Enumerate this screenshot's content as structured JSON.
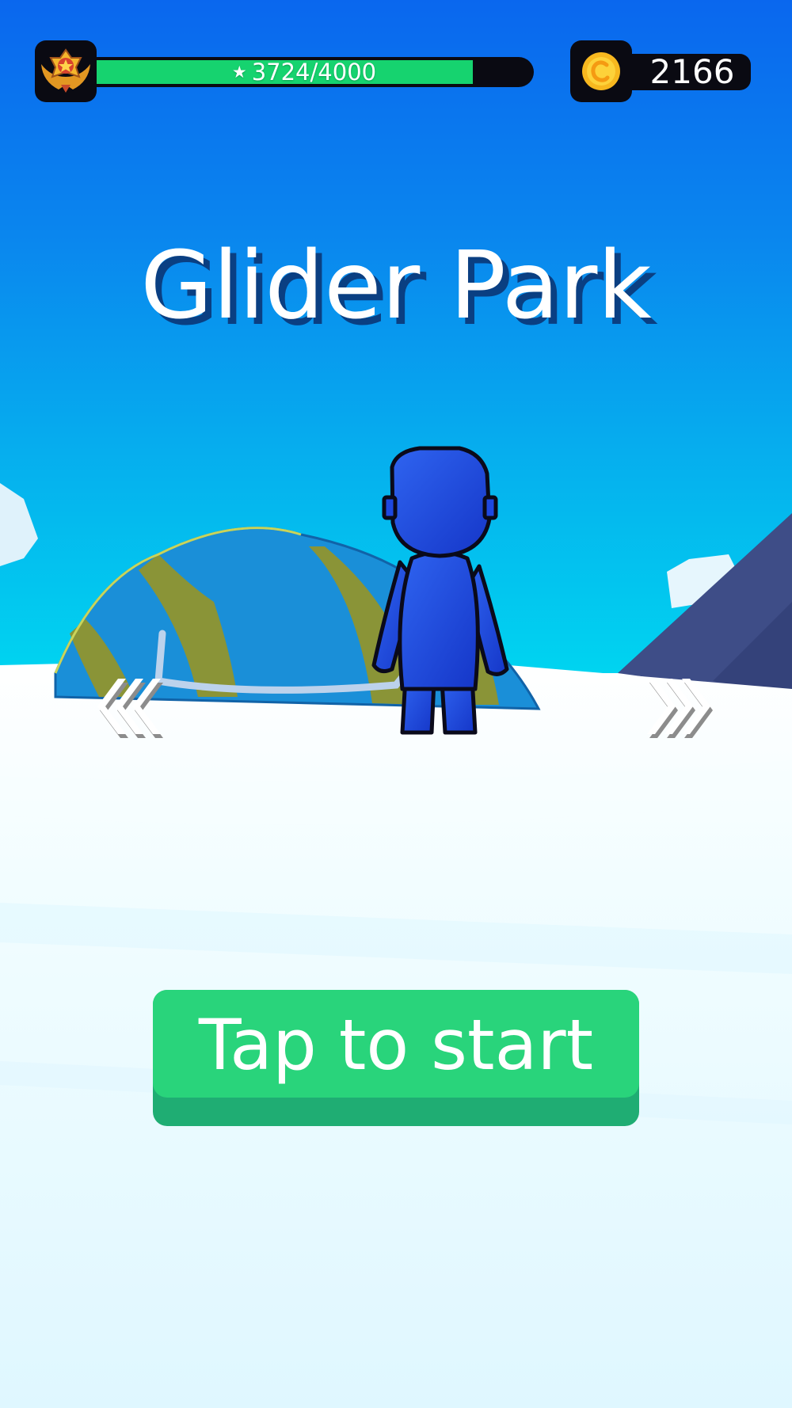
{
  "hud": {
    "xp": {
      "star_icon": "star-icon",
      "current": "3724",
      "separator": "/",
      "max": "4000",
      "progress_fraction": 0.931,
      "badge_icon": "rank-medal-icon"
    },
    "coins": {
      "icon": "coin-icon",
      "count": "2166"
    }
  },
  "level": {
    "title": "Glider Park"
  },
  "character_select": {
    "prev_icon": "chevron-left-icon",
    "next_icon": "chevron-right-icon"
  },
  "start_button": {
    "label": "Tap to start"
  },
  "colors": {
    "sky_top": "#0a67ee",
    "sky_horizon": "#00ccee",
    "snow": "#e8fbff",
    "xp_bar": "#16d36f",
    "button_face": "#29d47b",
    "button_shadow": "#1fad73",
    "character": "#1e48e0",
    "glider_blue": "#1a8fd8",
    "glider_stripe": "#8a9437",
    "title_shadow": "#0a3f82"
  }
}
